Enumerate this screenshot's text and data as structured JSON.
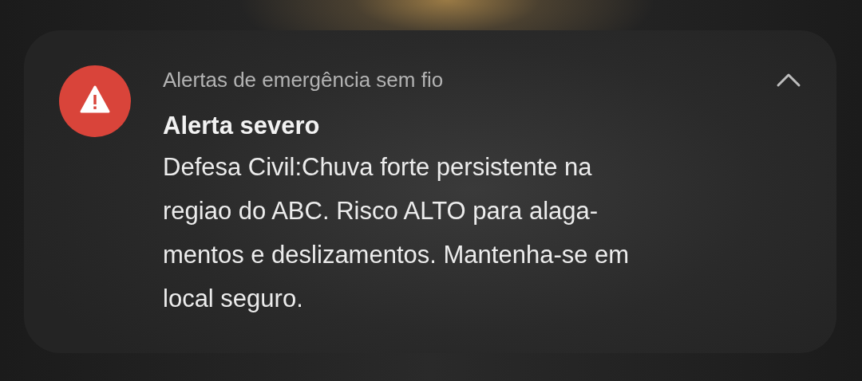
{
  "notification": {
    "app_name": "Alertas de emergência sem fio",
    "expanded": true,
    "title": "Alerta severo",
    "body_lines": [
      "Defesa Civil:Chuva forte persistente na",
      "regiao do ABC. Risco ALTO para alaga-",
      "mentos e deslizamentos. Mantenha-se em",
      "local seguro."
    ]
  }
}
